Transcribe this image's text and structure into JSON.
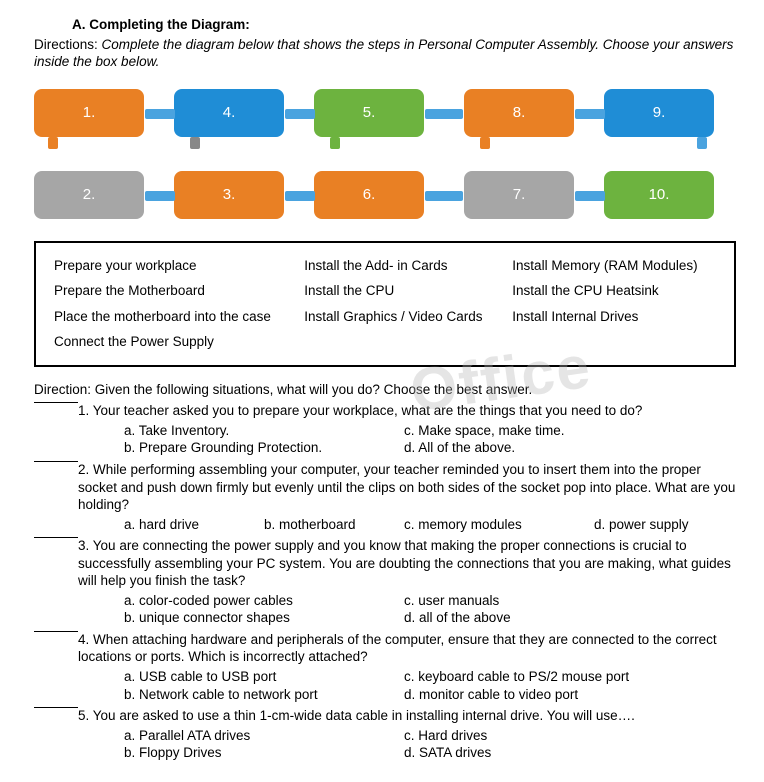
{
  "header": {
    "section_label": "A.  Completing the Diagram:",
    "directions_lead": "Directions: ",
    "directions_body": "Complete the diagram below that shows the steps in Personal Computer Assembly. Choose your answers inside the box below."
  },
  "diagram_boxes": {
    "b1": "1.",
    "b2": "2.",
    "b3": "3.",
    "b4": "4.",
    "b5": "5.",
    "b6": "6.",
    "b7": "7.",
    "b8": "8.",
    "b9": "9.",
    "b10": "10."
  },
  "answer_bank": {
    "r1c1": "Prepare your workplace",
    "r1c2": "Install the Add- in Cards",
    "r1c3": "Install Memory (RAM Modules)",
    "r2c1": "Prepare the Motherboard",
    "r2c2": "Install the CPU",
    "r2c3": "Install the CPU Heatsink",
    "r3c1": "Place the motherboard into the case",
    "r3c2": "Install Graphics / Video Cards",
    "r3c3": "Install Internal Drives",
    "r4c1": "Connect the Power Supply"
  },
  "section_b": {
    "directions_lead": "Direction: ",
    "directions_body": "Given the following situations, what will you do? Choose the best answer."
  },
  "questions": {
    "q1": {
      "num": "1.",
      "text": "Your teacher asked you to prepare your workplace, what are the things that you need to do?",
      "a": "a.   Take Inventory.",
      "b": "b.   Prepare Grounding Protection.",
      "c": "c. Make space, make time.",
      "d": "d. All of the above."
    },
    "q2": {
      "num": "2.",
      "text": "While performing assembling your computer, your teacher reminded you to insert them into the proper socket and push down firmly but evenly until the clips on both sides of the socket pop into place. What are you holding?",
      "a": "a.   hard drive",
      "b": "b. motherboard",
      "c": "c. memory modules",
      "d": "d. power supply"
    },
    "q3": {
      "num": "3.",
      "text": "You are connecting the power supply and you know that making the proper connections is crucial to successfully assembling your PC system. You are doubting the connections that you are making, what guides will help you finish the task?",
      "a": "a.   color-coded power cables",
      "b": "b.   unique connector shapes",
      "c": "c. user manuals",
      "d": "d. all of the above"
    },
    "q4": {
      "num": "4.",
      "text": "When attaching hardware and peripherals of the computer, ensure that they are connected to the correct locations or ports. Which is incorrectly attached?",
      "a": "a.   USB cable to USB port",
      "b": "b.   Network cable to network port",
      "c": "c. keyboard cable to PS/2 mouse port",
      "d": "d. monitor cable to video port"
    },
    "q5": {
      "num": "5.",
      "text": "You are asked to use a thin 1-cm-wide data cable in installing internal drive. You will use….",
      "a": "a.   Parallel ATA drives",
      "b": "b.   Floppy Drives",
      "c": "c. Hard drives",
      "d": "d. SATA drives"
    }
  },
  "watermark": "Office"
}
